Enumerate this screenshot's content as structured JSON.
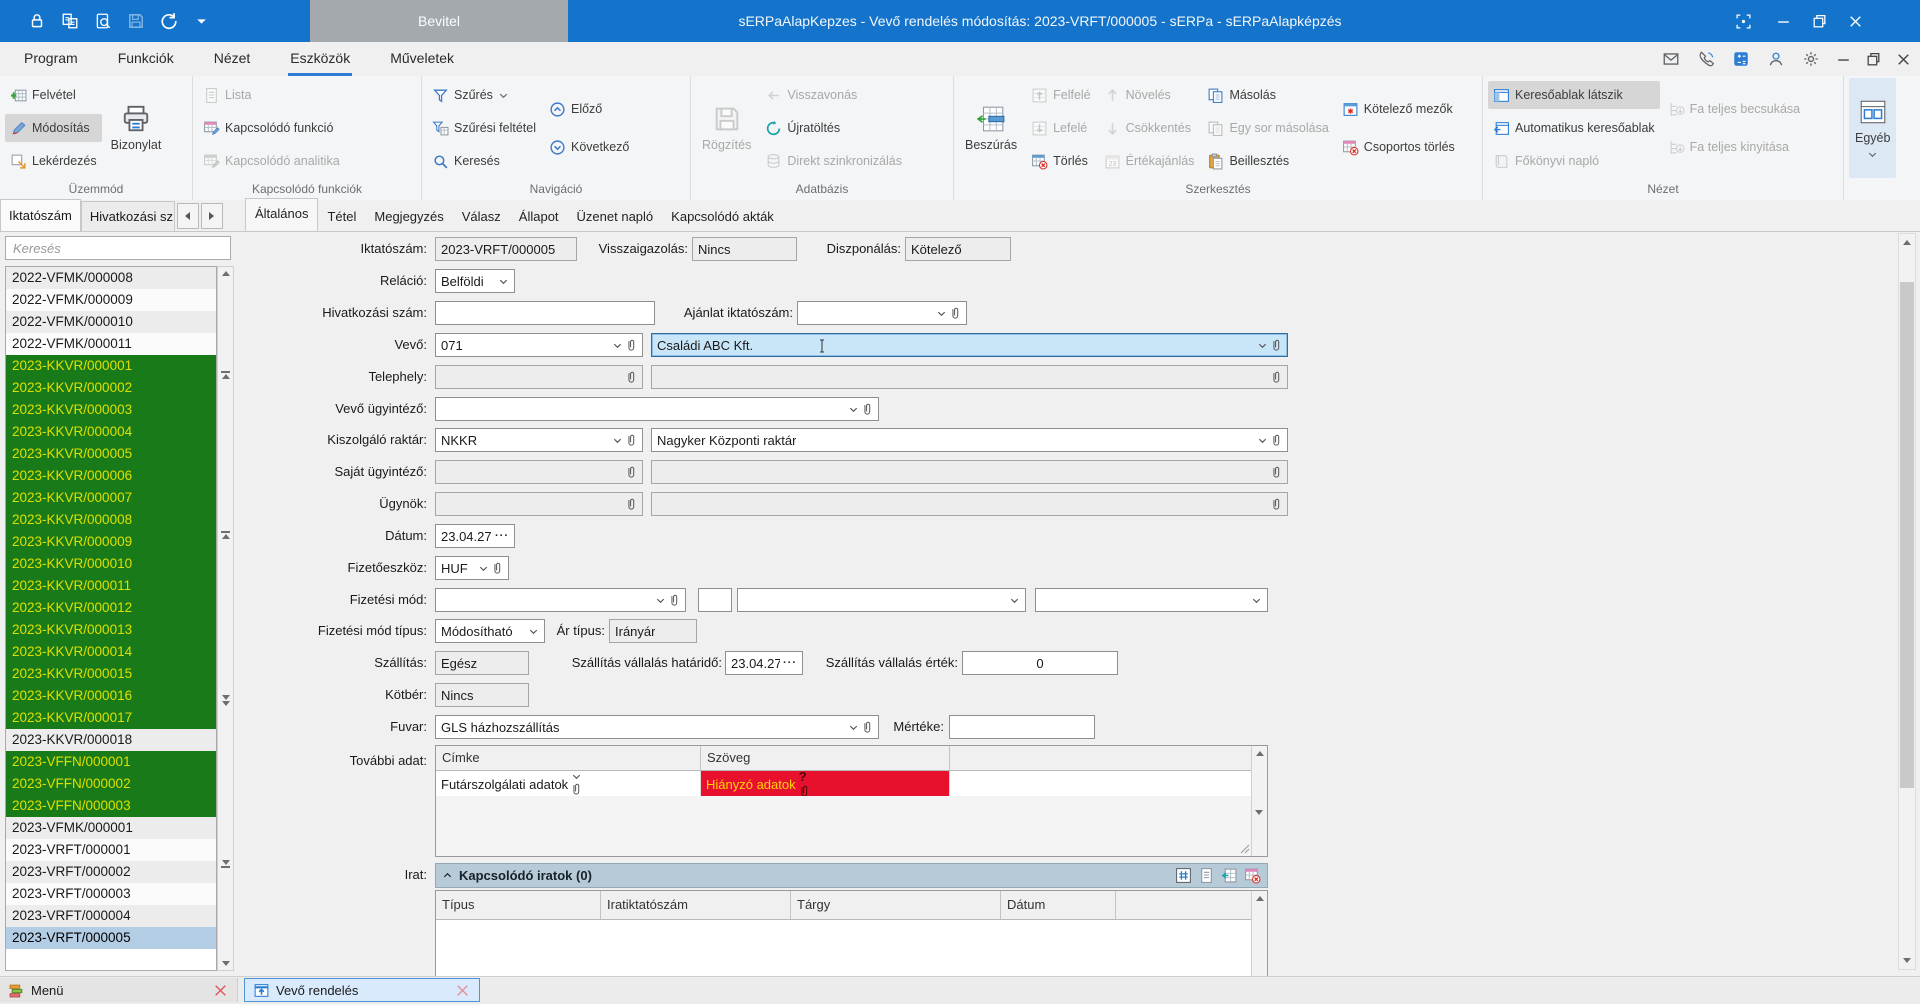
{
  "titlebar": {
    "title": "sERPaAlapKepzes - Vevő rendelés módosítás: 2023-VRFT/000005 - sERPa - sERPaAlapképzés",
    "tab": "Bevitel"
  },
  "menubar": {
    "items": [
      {
        "label": "Program"
      },
      {
        "label": "Funkciók"
      },
      {
        "label": "Nézet"
      },
      {
        "label": "Eszközök",
        "cls": "active"
      },
      {
        "label": "Műveletek"
      }
    ]
  },
  "ribbon": {
    "uzemmod": {
      "label": "Üzemmód",
      "felvetel": "Felvétel",
      "modositas": "Módosítás",
      "lekerdezes": "Lekérdezés",
      "bizonylat": "Bizonylat"
    },
    "kapcsolodo": {
      "label": "Kapcsolódó funkciók",
      "lista": "Lista",
      "funkcio": "Kapcsolódó funkció",
      "analitika": "Kapcsolódó analitika"
    },
    "navigacio": {
      "label": "Navigáció",
      "szures": "Szűrés",
      "feltetel": "Szűrési feltétel",
      "kereses": "Keresés",
      "elozo": "Előző",
      "kovetkezo": "Következő"
    },
    "adatbazis": {
      "label": "Adatbázis",
      "rogzites": "Rögzítés",
      "visszavonas": "Visszavonás",
      "ujratoltes": "Újratöltés",
      "direkt": "Direkt szinkronizálás"
    },
    "szerkesztes": {
      "label": "Szerkesztés",
      "beszuras": "Beszúrás",
      "felfele": "Felfelé",
      "lefele": "Lefelé",
      "torles": "Törlés",
      "noveles": "Növelés",
      "csokkentes": "Csökkentés",
      "ertekajanlas": "Értékajánlás",
      "masolas": "Másolás",
      "egysor": "Egy sor másolása",
      "beillesztes": "Beillesztés",
      "kotelezo": "Kötelező mezők",
      "csoportos": "Csoportos törlés"
    },
    "nezet": {
      "label": "Nézet",
      "keresoablak": "Keresőablak látszik",
      "automatikus": "Automatikus keresőablak",
      "fokonyvi": "Főkönyvi napló",
      "fabecsukasa": "Fa teljes becsukása",
      "fakinyitasa": "Fa teljes kinyitása"
    },
    "egyeb": {
      "label": "Egyéb"
    }
  },
  "sidebar": {
    "tabs": {
      "iktatoszam": "Iktatószám",
      "hivatkozasi": "Hivatkozási sz"
    },
    "search_placeholder": "Keresés",
    "items": [
      {
        "label": "2022-VFMK/000008",
        "state": "alt"
      },
      {
        "label": "2022-VFMK/000009",
        "state": "plain"
      },
      {
        "label": "2022-VFMK/000010",
        "state": "alt"
      },
      {
        "label": "2022-VFMK/000011",
        "state": "plain"
      },
      {
        "label": "2023-KKVR/000001",
        "state": "green"
      },
      {
        "label": "2023-KKVR/000002",
        "state": "green"
      },
      {
        "label": "2023-KKVR/000003",
        "state": "green"
      },
      {
        "label": "2023-KKVR/000004",
        "state": "green"
      },
      {
        "label": "2023-KKVR/000005",
        "state": "green"
      },
      {
        "label": "2023-KKVR/000006",
        "state": "green"
      },
      {
        "label": "2023-KKVR/000007",
        "state": "green"
      },
      {
        "label": "2023-KKVR/000008",
        "state": "green"
      },
      {
        "label": "2023-KKVR/000009",
        "state": "green"
      },
      {
        "label": "2023-KKVR/000010",
        "state": "green"
      },
      {
        "label": "2023-KKVR/000011",
        "state": "green"
      },
      {
        "label": "2023-KKVR/000012",
        "state": "green"
      },
      {
        "label": "2023-KKVR/000013",
        "state": "green"
      },
      {
        "label": "2023-KKVR/000014",
        "state": "green"
      },
      {
        "label": "2023-KKVR/000015",
        "state": "green"
      },
      {
        "label": "2023-KKVR/000016",
        "state": "green"
      },
      {
        "label": "2023-KKVR/000017",
        "state": "green"
      },
      {
        "label": "2023-KKVR/000018",
        "state": "alt"
      },
      {
        "label": "2023-VFFN/000001",
        "state": "green"
      },
      {
        "label": "2023-VFFN/000002",
        "state": "green"
      },
      {
        "label": "2023-VFFN/000003",
        "state": "green"
      },
      {
        "label": "2023-VFMK/000001",
        "state": "alt"
      },
      {
        "label": "2023-VRFT/000001",
        "state": "plain"
      },
      {
        "label": "2023-VRFT/000002",
        "state": "alt"
      },
      {
        "label": "2023-VRFT/000003",
        "state": "plain"
      },
      {
        "label": "2023-VRFT/000004",
        "state": "alt"
      },
      {
        "label": "2023-VRFT/000005",
        "state": "selected"
      }
    ]
  },
  "formtabs": [
    {
      "label": "Általános",
      "cls": "active"
    },
    {
      "label": "Tétel"
    },
    {
      "label": "Megjegyzés"
    },
    {
      "label": "Válasz"
    },
    {
      "label": "Állapot"
    },
    {
      "label": "Üzenet napló"
    },
    {
      "label": "Kapcsolódó akták"
    }
  ],
  "form": {
    "iktatoszam": {
      "label": "Iktatószám:",
      "value": "2023-VRFT/000005"
    },
    "visszaigazolas": {
      "label": "Visszaigazolás:",
      "value": "Nincs"
    },
    "diszponalas": {
      "label": "Diszponálás:",
      "value": "Kötelező"
    },
    "relacio": {
      "label": "Reláció:",
      "value": "Belföldi"
    },
    "hivatkozasi": {
      "label": "Hivatkozási szám:",
      "value": ""
    },
    "ajanlat": {
      "label": "Ajánlat iktatószám:",
      "value": ""
    },
    "vevo": {
      "label": "Vevő:",
      "code": "071",
      "name": "Családi ABC Kft."
    },
    "telephely": {
      "label": "Telephely:",
      "code": "",
      "name": ""
    },
    "vevo_ugyintezo": {
      "label": "Vevő ügyintéző:",
      "value": ""
    },
    "kiszolgalo_raktar": {
      "label": "Kiszolgáló raktár:",
      "code": "NKKR",
      "name": "Nagyker Központi raktár"
    },
    "sajat_ugyintezo": {
      "label": "Saját ügyintéző:",
      "code": "",
      "name": ""
    },
    "ugynok": {
      "label": "Ügynök:",
      "code": "",
      "name": ""
    },
    "datum": {
      "label": "Dátum:",
      "value": "23.04.27.",
      "browse": "···"
    },
    "fizetoeszkoz": {
      "label": "Fizetőeszköz:",
      "value": "HUF"
    },
    "fizetesi_mod": {
      "label": "Fizetési mód:",
      "value": ""
    },
    "fizetesi_mod_tipus": {
      "label": "Fizetési mód típus:",
      "value": "Módosítható"
    },
    "ar_tipus": {
      "label": "Ár típus:",
      "value": "Irányár"
    },
    "szallitas": {
      "label": "Szállítás:",
      "value": "Egész"
    },
    "szallitas_hatarido": {
      "label": "Szállítás vállalás határidő:",
      "value": "23.04.27.",
      "browse": "···"
    },
    "szallitas_ertek": {
      "label": "Szállítás vállalás érték:",
      "value": "0"
    },
    "kotber": {
      "label": "Kötbér:",
      "value": "Nincs"
    },
    "fuvar": {
      "label": "Fuvar:",
      "value": "GLS házhozszállítás"
    },
    "merteke": {
      "label": "Mértéke:",
      "value": ""
    }
  },
  "tovabbi": {
    "label": "További adat:",
    "col_cimke": "Címke",
    "col_szoveg": "Szöveg",
    "row": {
      "cimke": "Futárszolgálati adatok",
      "szoveg": "Hiányzó adatok",
      "warn": "?"
    }
  },
  "irat": {
    "label": "Irat:",
    "title": "Kapcsolódó iratok (0)",
    "cols": {
      "tipus": "Típus",
      "iratiktatoszam": "Iratiktatószám",
      "targy": "Tárgy",
      "datum": "Dátum"
    }
  },
  "taskbar": {
    "menu": "Menü",
    "doc": "Vevő rendelés"
  },
  "colors": {
    "titlebar_blue": "#1474cc",
    "accent_blue": "#2b7cd3",
    "green_row_bg": "#187a18",
    "green_row_text": "#dce000",
    "selected_row_bg": "#b3cde4",
    "error_bg": "#e8112d",
    "error_text": "#ffd400",
    "focus_field_bg": "#c9e6f9"
  }
}
